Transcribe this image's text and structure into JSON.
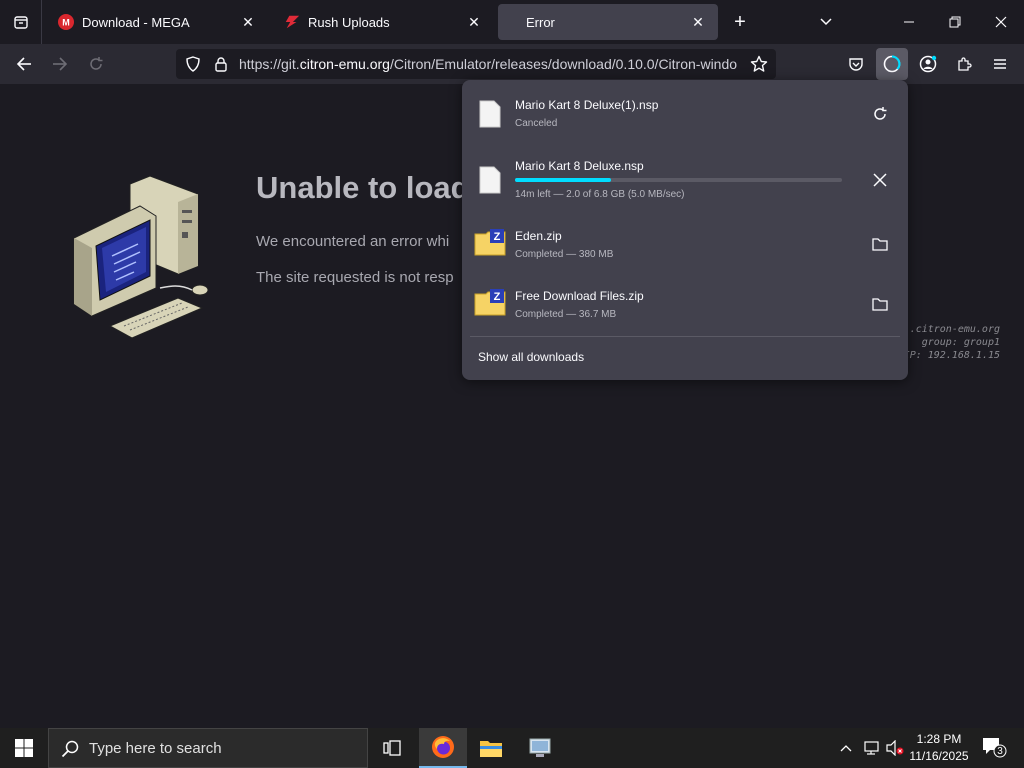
{
  "tabs": [
    {
      "title": "Download - MEGA",
      "close": "✕"
    },
    {
      "title": "Rush Uploads",
      "close": "✕"
    },
    {
      "title": "Error",
      "close": "✕"
    }
  ],
  "newtab": "+",
  "window_controls": {
    "minimize": "–",
    "maximize": "❐",
    "close": "✕"
  },
  "url": {
    "prefix": "https://git.",
    "domain": "citron-emu.org",
    "path": "/Citron/Emulator/releases/download/0.10.0/Citron-windo"
  },
  "page": {
    "title": "Unable to load",
    "line1": "We encountered an error whi",
    "line2": "The site requested is not resp",
    "server_info": [
      ".citron-emu.org",
      "group: group1",
      "IP: 192.168.1.15"
    ]
  },
  "downloads": {
    "items": [
      {
        "name": "Mario Kart 8 Deluxe(1).nsp",
        "status": "Canceled",
        "action": "retry-icon",
        "file_icon": "file-icon"
      },
      {
        "name": "Mario Kart 8 Deluxe.nsp",
        "status": "14m left — 2.0 of 6.8 GB (5.0 MB/sec)",
        "progress": 0.294,
        "action": "cancel-icon",
        "file_icon": "file-icon"
      },
      {
        "name": "Eden.zip",
        "status": "Completed — 380 MB",
        "action": "folder-icon",
        "file_icon": "zip-folder-icon"
      },
      {
        "name": "Free Download Files.zip",
        "status": "Completed — 36.7 MB",
        "action": "folder-icon",
        "file_icon": "zip-folder-icon"
      }
    ],
    "show_all": "Show all downloads"
  },
  "taskbar": {
    "search_placeholder": "Type here to search",
    "time": "1:28 PM",
    "date": "11/16/2025",
    "notification_count": "3"
  },
  "colors": {
    "accent": "#00ddff",
    "mega": "#d9272e",
    "rush": "#e02b38"
  }
}
